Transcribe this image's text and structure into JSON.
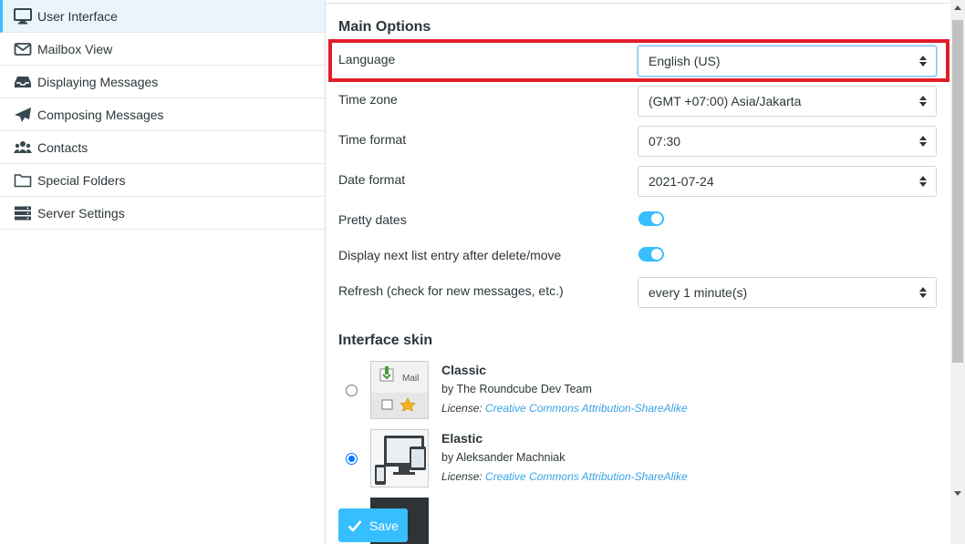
{
  "sidebar": {
    "items": [
      {
        "label": "User Interface",
        "icon": "monitor-icon"
      },
      {
        "label": "Mailbox View",
        "icon": "envelope-icon"
      },
      {
        "label": "Displaying Messages",
        "icon": "inbox-icon"
      },
      {
        "label": "Composing Messages",
        "icon": "paper-plane-icon"
      },
      {
        "label": "Contacts",
        "icon": "users-icon"
      },
      {
        "label": "Special Folders",
        "icon": "folder-icon"
      },
      {
        "label": "Server Settings",
        "icon": "server-icon"
      }
    ]
  },
  "main": {
    "section_main": "Main Options",
    "language": {
      "label": "Language",
      "value": "English (US)"
    },
    "timezone": {
      "label": "Time zone",
      "value": "(GMT +07:00) Asia/Jakarta"
    },
    "time_format": {
      "label": "Time format",
      "value": "07:30"
    },
    "date_format": {
      "label": "Date format",
      "value": "2021-07-24"
    },
    "pretty_dates": {
      "label": "Pretty dates",
      "enabled": true
    },
    "next_entry": {
      "label": "Display next list entry after delete/move",
      "enabled": true
    },
    "refresh": {
      "label": "Refresh (check for new messages, etc.)",
      "value": "every 1 minute(s)"
    },
    "section_skin": "Interface skin",
    "skins": [
      {
        "name": "Classic",
        "author": "by The Roundcube Dev Team",
        "license_prefix": "License:",
        "license": "Creative Commons Attribution-ShareAlike",
        "selected": false,
        "thumb_text": "Mail"
      },
      {
        "name": "Elastic",
        "author": "by Aleksander Machniak",
        "license_prefix": "License:",
        "license": "Creative Commons Attribution-ShareAlike",
        "selected": true
      }
    ],
    "save_label": "Save"
  },
  "colors": {
    "accent": "#37beff",
    "highlight": "#e11d2a",
    "link": "#37a3e6"
  }
}
